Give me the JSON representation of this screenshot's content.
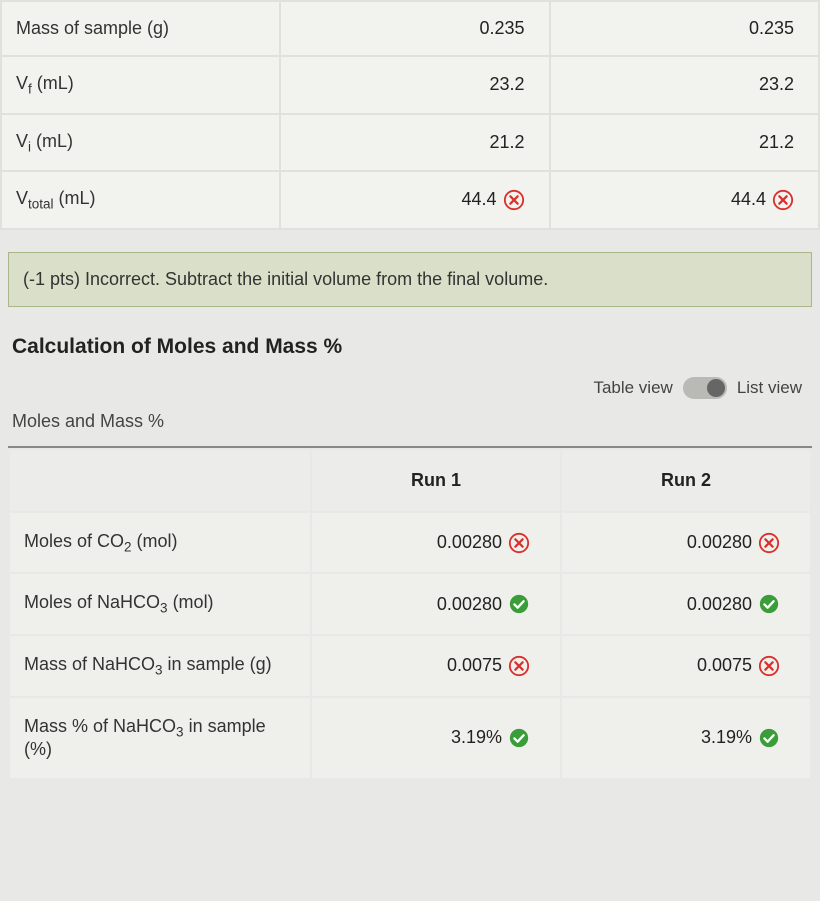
{
  "table1": {
    "rows": [
      {
        "label_html": "Mass of sample (g)",
        "run1": "0.235",
        "run2": "0.235",
        "status": null
      },
      {
        "label_html": "V<sub>f</sub> (mL)",
        "run1": "23.2",
        "run2": "23.2",
        "status": null
      },
      {
        "label_html": "V<sub>i</sub> (mL)",
        "run1": "21.2",
        "run2": "21.2",
        "status": null
      },
      {
        "label_html": "V<sub>total</sub> (mL)",
        "run1": "44.4",
        "run2": "44.4",
        "status": "wrong"
      }
    ]
  },
  "feedback": "(-1 pts) Incorrect. Subtract the initial volume from the final volume.",
  "section_title": "Calculation of Moles and Mass %",
  "view_toggle": {
    "left": "Table view",
    "right": "List view"
  },
  "subheading": "Moles and Mass %",
  "table2": {
    "headers": [
      "",
      "Run 1",
      "Run 2"
    ],
    "rows": [
      {
        "label_html": "Moles of CO<sub>2</sub> (mol)",
        "run1": "0.00280",
        "run1_status": "wrong",
        "run2": "0.00280",
        "run2_status": "wrong"
      },
      {
        "label_html": "Moles of NaHCO<sub>3</sub> (mol)",
        "run1": "0.00280",
        "run1_status": "correct",
        "run2": "0.00280",
        "run2_status": "correct"
      },
      {
        "label_html": "Mass of NaHCO<sub>3</sub> in sample (g)",
        "run1": "0.0075",
        "run1_status": "wrong",
        "run2": "0.0075",
        "run2_status": "wrong"
      },
      {
        "label_html": "Mass % of NaHCO<sub>3</sub> in sample (%)",
        "run1": "3.19%",
        "run1_status": "correct",
        "run2": "3.19%",
        "run2_status": "correct"
      }
    ]
  }
}
